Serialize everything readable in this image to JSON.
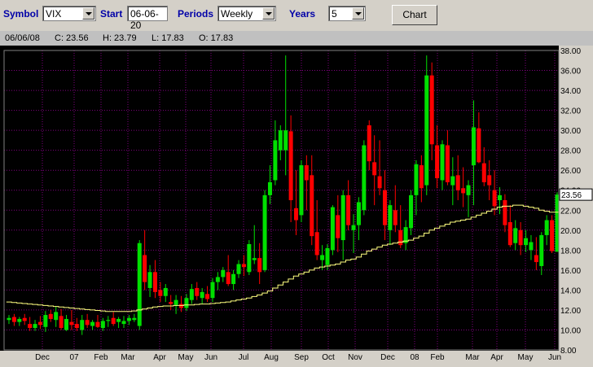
{
  "toolbar": {
    "symbol_label": "Symbol",
    "symbol_value": "VIX",
    "start_label": "Start",
    "start_value": "06-06-20",
    "periods_label": "Periods",
    "periods_value": "Weekly",
    "years_label": "Years",
    "years_value": "5",
    "chart_button": "Chart"
  },
  "info": {
    "date": "06/06/08",
    "close": "C: 23.56",
    "high": "H: 23.79",
    "low": "L: 17.83",
    "open": "O: 17.83"
  },
  "colors": {
    "up": "#00e000",
    "down": "#ff0000",
    "ma": "#ffff80",
    "grid": "#800080",
    "axis_text": "#000000",
    "label_box": "#ffffff"
  },
  "chart_data": {
    "type": "candlestick",
    "ylim": [
      8,
      38
    ],
    "yticks": [
      "38.00",
      "36.00",
      "34.00",
      "32.00",
      "30.00",
      "28.00",
      "26.00",
      "24.00",
      "22.00",
      "20.00",
      "18.00",
      "16.00",
      "14.00",
      "12.00",
      "10.00",
      "8.00"
    ],
    "x_labels": [
      "Dec",
      "07",
      "Feb",
      "Mar",
      "Apr",
      "May",
      "Jun",
      "Jul",
      "Aug",
      "Sep",
      "Oct",
      "Nov",
      "Dec",
      "08",
      "Feb",
      "Mar",
      "Apr",
      "May",
      "Jun"
    ],
    "last_price_label": "23.56",
    "series": [
      {
        "name": "ohlc",
        "values": [
          [
            11.0,
            11.5,
            10.6,
            11.2
          ],
          [
            11.3,
            11.6,
            10.4,
            10.8
          ],
          [
            10.8,
            11.3,
            10.4,
            11.1
          ],
          [
            11.2,
            11.6,
            10.5,
            10.9
          ],
          [
            10.6,
            11.3,
            9.9,
            10.2
          ],
          [
            10.2,
            11.0,
            9.9,
            10.6
          ],
          [
            10.8,
            11.4,
            10.1,
            10.5
          ],
          [
            10.3,
            11.9,
            9.8,
            11.5
          ],
          [
            11.6,
            12.0,
            10.8,
            11.1
          ],
          [
            11.0,
            12.4,
            10.3,
            11.8
          ],
          [
            11.4,
            12.1,
            10.0,
            10.2
          ],
          [
            10.0,
            11.5,
            9.9,
            11.1
          ],
          [
            10.8,
            12.0,
            10.0,
            10.5
          ],
          [
            10.6,
            11.2,
            9.9,
            10.2
          ],
          [
            10.0,
            11.5,
            9.5,
            11.0
          ],
          [
            11.0,
            11.6,
            10.2,
            10.5
          ],
          [
            10.4,
            11.0,
            10.0,
            10.8
          ],
          [
            10.8,
            11.5,
            10.2,
            10.3
          ],
          [
            10.2,
            11.2,
            9.9,
            10.9
          ],
          [
            10.9,
            11.4,
            10.3,
            11.0
          ],
          [
            11.2,
            11.8,
            10.4,
            10.6
          ],
          [
            10.8,
            11.3,
            10.2,
            11.1
          ],
          [
            10.6,
            11.4,
            10.2,
            10.9
          ],
          [
            10.9,
            11.5,
            10.5,
            11.2
          ],
          [
            11.0,
            11.6,
            10.8,
            11.2
          ],
          [
            10.4,
            19.0,
            10.0,
            18.7
          ],
          [
            17.5,
            20.0,
            14.0,
            14.8
          ],
          [
            14.2,
            16.5,
            13.3,
            15.8
          ],
          [
            15.8,
            17.0,
            13.2,
            13.8
          ],
          [
            14.0,
            14.8,
            12.8,
            13.4
          ],
          [
            13.4,
            14.6,
            12.8,
            14.2
          ],
          [
            12.8,
            13.5,
            12.0,
            12.6
          ],
          [
            12.5,
            13.5,
            11.6,
            13.0
          ],
          [
            12.6,
            13.4,
            11.8,
            12.2
          ],
          [
            12.2,
            13.6,
            11.9,
            13.2
          ],
          [
            13.0,
            14.6,
            12.6,
            14.1
          ],
          [
            14.2,
            14.8,
            13.0,
            13.4
          ],
          [
            13.2,
            14.2,
            12.6,
            13.8
          ],
          [
            13.6,
            14.4,
            12.8,
            13.1
          ],
          [
            13.2,
            15.2,
            12.8,
            14.8
          ],
          [
            14.8,
            15.8,
            14.0,
            15.3
          ],
          [
            15.3,
            16.3,
            14.8,
            16.0
          ],
          [
            15.8,
            17.5,
            14.4,
            14.6
          ],
          [
            14.6,
            16.0,
            14.0,
            15.6
          ],
          [
            15.6,
            17.0,
            15.2,
            16.6
          ],
          [
            16.6,
            17.5,
            15.4,
            16.3
          ],
          [
            15.8,
            19.0,
            15.5,
            18.6
          ],
          [
            17.0,
            20.5,
            16.6,
            17.2
          ],
          [
            17.2,
            18.7,
            14.6,
            15.8
          ],
          [
            16.0,
            24.0,
            15.8,
            23.5
          ],
          [
            23.5,
            26.5,
            22.6,
            24.8
          ],
          [
            25.0,
            31.0,
            24.5,
            29.0
          ],
          [
            28.0,
            30.5,
            27.0,
            30.0
          ],
          [
            28.0,
            37.5,
            25.5,
            30.0
          ],
          [
            29.9,
            31.5,
            20.8,
            23.0
          ],
          [
            22.2,
            26.0,
            19.5,
            21.0
          ],
          [
            21.5,
            27.0,
            20.8,
            26.5
          ],
          [
            26.5,
            27.5,
            22.0,
            25.0
          ],
          [
            25.5,
            27.5,
            18.5,
            19.4
          ],
          [
            19.8,
            23.0,
            17.0,
            17.5
          ],
          [
            17.0,
            18.5,
            16.0,
            17.5
          ],
          [
            16.5,
            18.6,
            16.0,
            18.2
          ],
          [
            18.0,
            22.5,
            17.5,
            22.3
          ],
          [
            21.5,
            23.5,
            17.8,
            19.2
          ],
          [
            19.0,
            24.0,
            17.0,
            23.5
          ],
          [
            23.5,
            25.0,
            20.0,
            20.5
          ],
          [
            20.0,
            21.6,
            17.7,
            20.5
          ],
          [
            20.5,
            23.3,
            19.0,
            22.8
          ],
          [
            22.0,
            29.0,
            21.5,
            28.5
          ],
          [
            30.5,
            31.0,
            26.0,
            26.9
          ],
          [
            26.8,
            29.5,
            22.5,
            25.5
          ],
          [
            25.4,
            29.0,
            23.5,
            24.2
          ],
          [
            24.0,
            26.0,
            19.0,
            20.5
          ],
          [
            20.0,
            23.0,
            18.5,
            22.5
          ],
          [
            22.0,
            24.5,
            19.8,
            20.5
          ],
          [
            20.0,
            22.5,
            18.2,
            18.5
          ],
          [
            18.7,
            21.0,
            18.0,
            20.3
          ],
          [
            20.2,
            24.0,
            19.5,
            23.5
          ],
          [
            23.5,
            27.0,
            21.5,
            26.6
          ],
          [
            26.5,
            27.5,
            22.8,
            24.2
          ],
          [
            24.5,
            37.5,
            23.5,
            35.5
          ],
          [
            35.5,
            36.8,
            27.0,
            28.6
          ],
          [
            28.5,
            30.5,
            24.2,
            25.2
          ],
          [
            25.0,
            29.0,
            24.0,
            28.6
          ],
          [
            28.5,
            30.0,
            24.5,
            24.8
          ],
          [
            24.5,
            27.3,
            22.5,
            25.4
          ],
          [
            25.5,
            27.5,
            23.0,
            24.0
          ],
          [
            24.2,
            26.3,
            22.3,
            23.7
          ],
          [
            23.5,
            25.0,
            21.3,
            24.5
          ],
          [
            26.5,
            33.0,
            22.5,
            30.3
          ],
          [
            30.2,
            31.8,
            26.7,
            26.8
          ],
          [
            26.7,
            28.3,
            24.4,
            24.8
          ],
          [
            25.5,
            27.0,
            23.0,
            24.5
          ],
          [
            24.0,
            26.0,
            21.5,
            22.4
          ],
          [
            23.0,
            24.3,
            21.6,
            23.5
          ],
          [
            23.0,
            23.6,
            19.8,
            20.5
          ],
          [
            20.8,
            22.5,
            18.3,
            18.5
          ],
          [
            18.7,
            21.0,
            18.0,
            20.2
          ],
          [
            20.0,
            20.8,
            17.5,
            18.5
          ],
          [
            18.5,
            20.0,
            17.8,
            19.2
          ],
          [
            18.0,
            19.5,
            17.0,
            18.8
          ],
          [
            17.5,
            19.3,
            16.0,
            16.8
          ],
          [
            16.4,
            19.8,
            15.5,
            19.5
          ],
          [
            19.5,
            21.5,
            18.5,
            21.0
          ],
          [
            21.0,
            21.5,
            17.7,
            17.9
          ],
          [
            17.83,
            23.79,
            17.83,
            23.56
          ]
        ]
      },
      {
        "name": "ma",
        "values": [
          12.8,
          12.75,
          12.7,
          12.65,
          12.6,
          12.55,
          12.5,
          12.45,
          12.4,
          12.35,
          12.3,
          12.25,
          12.2,
          12.15,
          12.1,
          12.05,
          12.0,
          11.95,
          11.9,
          11.85,
          11.85,
          11.85,
          11.85,
          11.85,
          11.9,
          12.0,
          12.1,
          12.2,
          12.3,
          12.35,
          12.4,
          12.4,
          12.45,
          12.45,
          12.5,
          12.5,
          12.55,
          12.6,
          12.6,
          12.65,
          12.7,
          12.75,
          12.8,
          12.9,
          13.0,
          13.1,
          13.2,
          13.35,
          13.5,
          13.7,
          13.9,
          14.2,
          14.5,
          14.8,
          15.1,
          15.4,
          15.6,
          15.8,
          16.0,
          16.2,
          16.3,
          16.4,
          16.5,
          16.6,
          16.8,
          17.0,
          17.1,
          17.3,
          17.6,
          17.9,
          18.1,
          18.3,
          18.5,
          18.6,
          18.7,
          18.8,
          18.9,
          19.0,
          19.2,
          19.4,
          19.7,
          20.0,
          20.2,
          20.4,
          20.6,
          20.8,
          20.9,
          21.0,
          21.1,
          21.3,
          21.5,
          21.7,
          21.9,
          22.1,
          22.3,
          22.4,
          22.4,
          22.5,
          22.5,
          22.4,
          22.3,
          22.2,
          22.0,
          21.9,
          21.8,
          21.8
        ]
      }
    ]
  }
}
